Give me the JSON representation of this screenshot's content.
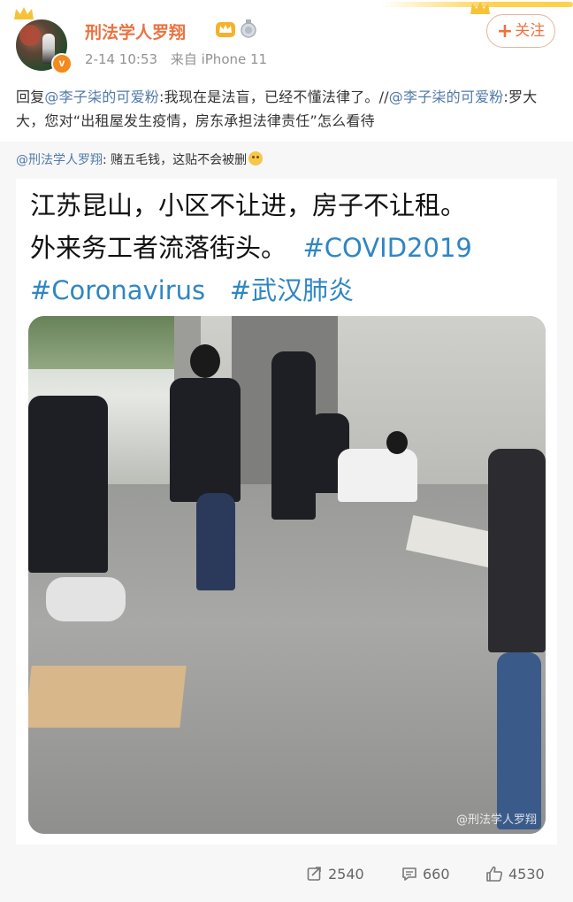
{
  "post": {
    "username": "刑法学人罗翔",
    "verified_badge": "v",
    "time": "2-14 10:53",
    "source": "来自 iPhone 11",
    "follow_label": "关注",
    "reply": {
      "prefix": "回复",
      "mention1": "@李子柒的可爱粉",
      "text1": ":我现在是法盲，已经不懂法律了。//",
      "mention2": "@李子柒的可爱粉",
      "text2": ":罗大大，您对“出租屋发生疫情，房东承担法律责任”怎么看待"
    }
  },
  "repost": {
    "mention": "@刑法学人罗翔",
    "text": ": 赌五毛钱，这贴不会被删",
    "caption_line1": "江苏昆山，小区不让进，房子不让租。",
    "caption_line2_text": "外来务工者流落街头。",
    "hashtag1": "#COVID2019",
    "hashtag2": "#Coronavirus",
    "hashtag3": "#武汉肺炎",
    "watermark": "@刑法学人罗翔"
  },
  "actions": {
    "repost_count": "2540",
    "comment_count": "660",
    "like_count": "4530"
  },
  "colors": {
    "username": "#eb7340",
    "mention": "#4f79a8",
    "hashtag": "#2f86c4",
    "repost_bg": "#f7f7f7"
  }
}
